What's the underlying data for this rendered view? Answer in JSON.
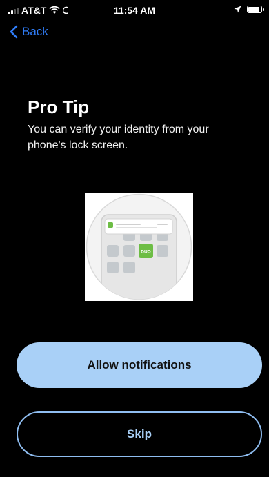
{
  "status": {
    "carrier": "AT&T",
    "time": "11:54 AM"
  },
  "nav": {
    "back_label": "Back"
  },
  "content": {
    "title": "Pro Tip",
    "description": "You can verify your identity from your phone's lock screen."
  },
  "illustration": {
    "app_label": "DUO"
  },
  "actions": {
    "allow_label": "Allow notifications",
    "skip_label": "Skip"
  },
  "colors": {
    "accent": "#2f7cf6",
    "primary_button": "#a9d0f7",
    "duo_green": "#6dbd45"
  }
}
